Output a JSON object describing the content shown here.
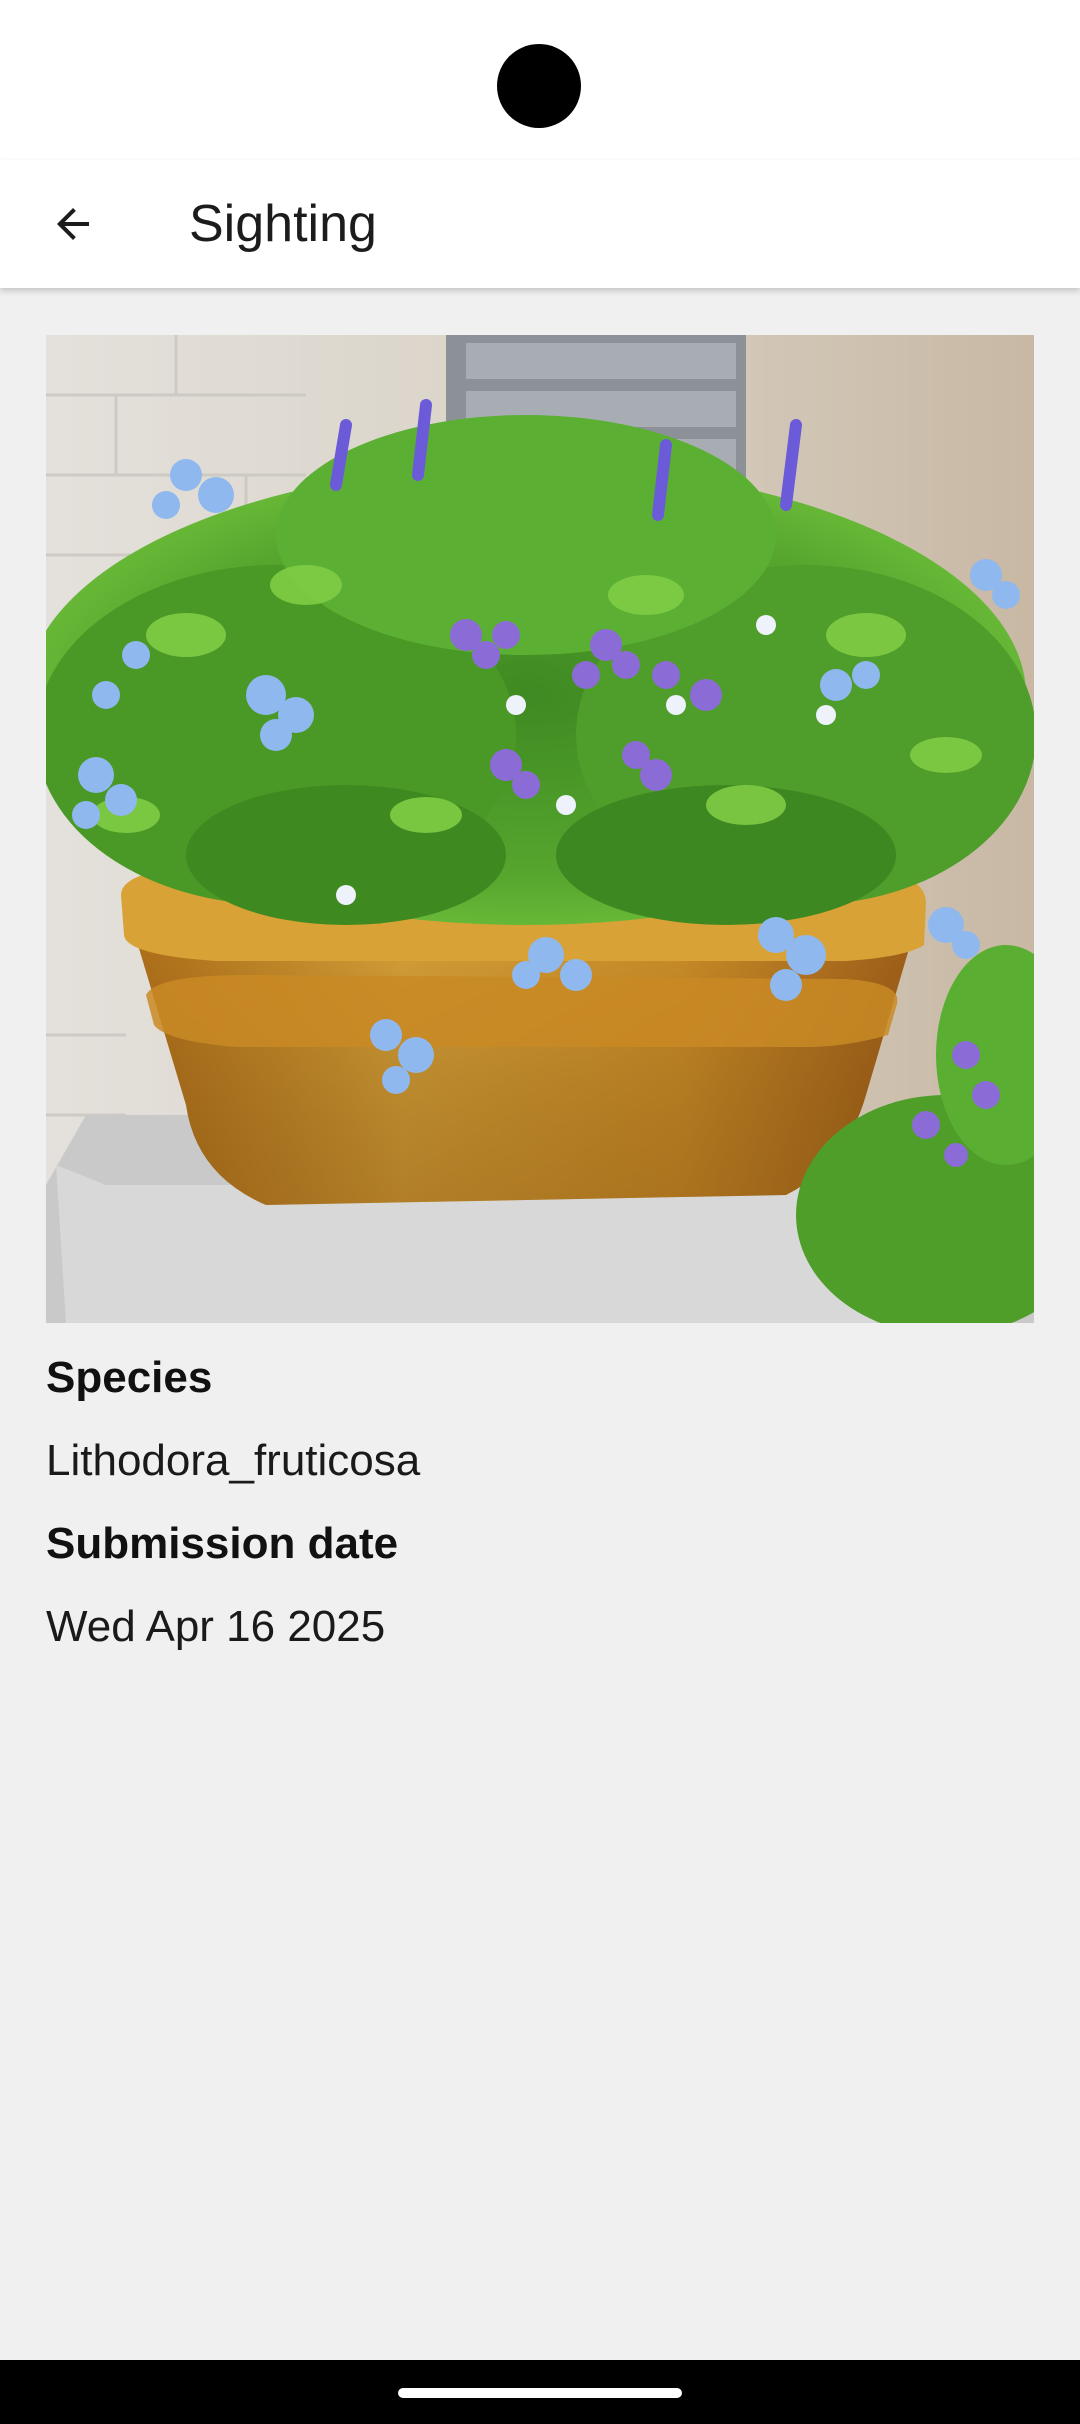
{
  "app_bar": {
    "title": "Sighting",
    "back_icon": "arrow-back-icon"
  },
  "sighting": {
    "photo_subject": "flower-pot-photo",
    "species_label": "Species",
    "species_value": "Lithodora_fruticosa",
    "date_label": "Submission date",
    "date_value": "Wed Apr 16 2025"
  },
  "colors": {
    "background": "#f0f0f0",
    "app_bar": "#ffffff",
    "text": "#1c1c1c"
  }
}
